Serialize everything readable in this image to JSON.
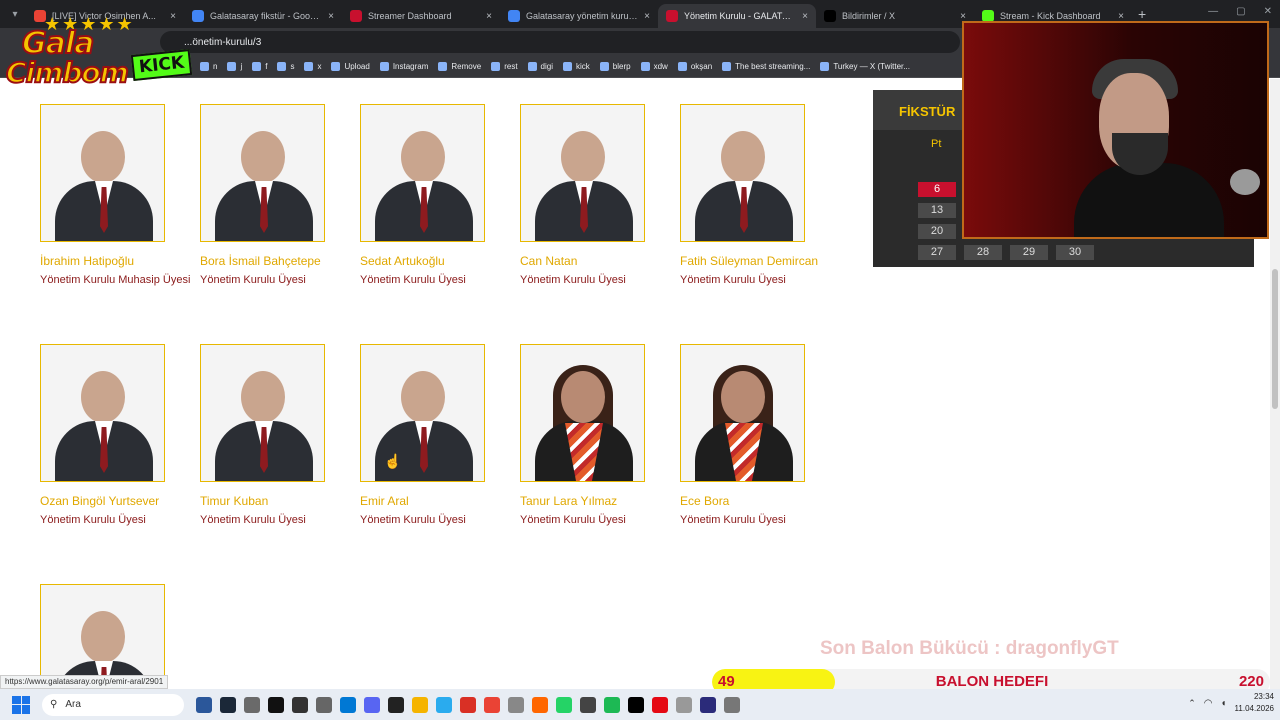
{
  "browser": {
    "tabs": [
      {
        "title": "[LIVE] Victor Osimhen A...",
        "favicon_color": "#ea4335",
        "active": false
      },
      {
        "title": "Galatasaray fikstür - Google'da",
        "favicon_color": "#4285f4",
        "active": false
      },
      {
        "title": "Streamer Dashboard",
        "favicon_color": "#c8102e",
        "active": false
      },
      {
        "title": "Galatasaray yönetim kurulu - G...",
        "favicon_color": "#4285f4",
        "active": false
      },
      {
        "title": "Yönetim Kurulu - GALATASARA...",
        "favicon_color": "#c8102e",
        "active": true
      },
      {
        "title": "Bildirimler / X",
        "favicon_color": "#000000",
        "active": false
      },
      {
        "title": "Stream - Kick Dashboard",
        "favicon_color": "#53fc18",
        "active": false
      }
    ],
    "new_tab_symbol": "+",
    "close_symbol": "×",
    "url": "...önetim-kurulu/3",
    "bookmarks": [
      "n",
      "j",
      "f",
      "s",
      "x",
      "Upload",
      "Instagram",
      "Remove",
      "rest",
      "digi",
      "kick",
      "blerp",
      "xdw",
      "okşan",
      "The best streaming...",
      "Turkey — X (Twitter..."
    ]
  },
  "overlay": {
    "logo_line1": "Gala",
    "logo_line2": "Cimbom",
    "logo_badge": "KICK",
    "logo_stars": "★★★★★",
    "last_balloon": "Son Balon Bükücü : dragonflyGT",
    "balloon_goal": {
      "label": "BALON HEDEFI",
      "current": "49",
      "target": "220",
      "fraction": 0.22
    }
  },
  "members": [
    {
      "name": "İbrahim Hatipoğlu",
      "role": "Yönetim Kurulu Muhasip Üyesi",
      "gender": "male"
    },
    {
      "name": "Bora İsmail Bahçetepe",
      "role": "Yönetim Kurulu Üyesi",
      "gender": "male"
    },
    {
      "name": "Sedat Artukoğlu",
      "role": "Yönetim Kurulu Üyesi",
      "gender": "male"
    },
    {
      "name": "Can Natan",
      "role": "Yönetim Kurulu Üyesi",
      "gender": "male"
    },
    {
      "name": "Fatih Süleyman Demircan",
      "role": "Yönetim Kurulu Üyesi",
      "gender": "male"
    },
    {
      "name": "Ozan Bingöl Yurtsever",
      "role": "Yönetim Kurulu Üyesi",
      "gender": "male"
    },
    {
      "name": "Timur Kuban",
      "role": "Yönetim Kurulu Üyesi",
      "gender": "male"
    },
    {
      "name": "Emir Aral",
      "role": "Yönetim Kurulu Üyesi",
      "gender": "male"
    },
    {
      "name": "Tanur Lara Yılmaz",
      "role": "Yönetim Kurulu Üyesi",
      "gender": "female"
    },
    {
      "name": "Ece Bora",
      "role": "Yönetim Kurulu Üyesi",
      "gender": "female"
    },
    {
      "name": "",
      "role": "",
      "gender": "male"
    }
  ],
  "fixture": {
    "title": "FİKSTÜR",
    "day_header": "Pt",
    "rows": [
      [
        "6"
      ],
      [
        "13"
      ],
      [
        "20"
      ],
      [
        "27",
        "28",
        "29",
        "30"
      ]
    ],
    "highlight": "6"
  },
  "status_link": "https://www.galatasaray.org/p/emir-aral/2901",
  "taskbar": {
    "search_placeholder": "Ara",
    "time": "23:34",
    "date": "11.04.2026",
    "icon_colors": [
      "#2b579a",
      "#1b2838",
      "#6a6a6a",
      "#111111",
      "#333333",
      "#666666",
      "#0078d4",
      "#5865f2",
      "#222222",
      "#f5b400",
      "#2aabee",
      "#d93025",
      "#ea4335",
      "#888888",
      "#ff6600",
      "#25d366",
      "#444444",
      "#1db954",
      "#000000",
      "#e50914",
      "#999999",
      "#2b2b7a",
      "#777777"
    ]
  }
}
